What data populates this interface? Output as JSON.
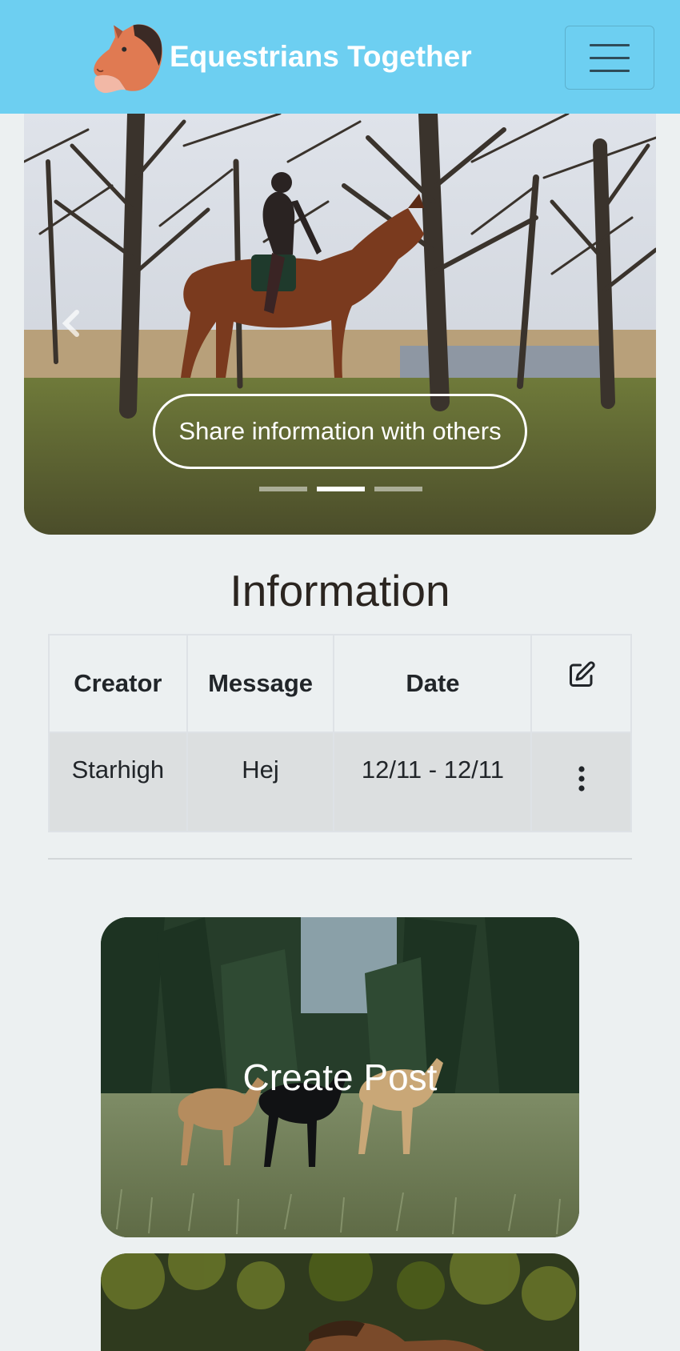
{
  "navbar": {
    "brand": "Equestrians Together",
    "logo_icon": "horse-head-logo",
    "toggler_icon": "hamburger-menu-icon"
  },
  "carousel": {
    "caption": "Share information with others",
    "slide_count": 3,
    "active_index": 1,
    "prev_icon": "chevron-left-icon",
    "next_icon": "chevron-right-icon"
  },
  "information": {
    "title": "Information",
    "columns": [
      "Creator",
      "Message",
      "Date"
    ],
    "edit_icon": "edit-pen-icon",
    "rows": [
      {
        "creator": "Starhigh",
        "message": "Hej",
        "date": "12/11 - 12/11",
        "menu_icon": "more-vertical-icon"
      }
    ]
  },
  "cards": {
    "create_post": "Create Post"
  },
  "colors": {
    "navbar": "#6dcff1",
    "background": "#ecf0f1",
    "row_bg": "#dcdfe0",
    "logo": "#e07a52"
  }
}
